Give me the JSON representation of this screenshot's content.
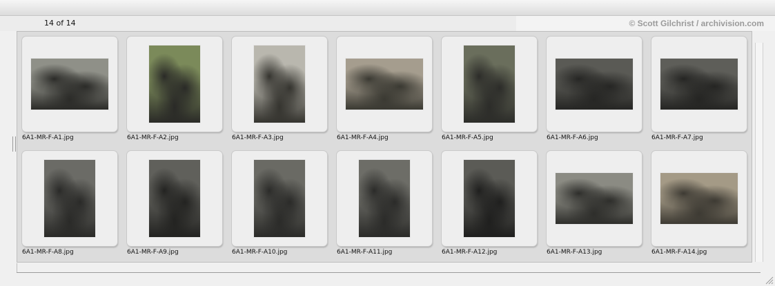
{
  "status": {
    "counter": "14 of 14"
  },
  "credit": "© Scott Gilchrist / archivision.com",
  "thumbnails": [
    {
      "filename": "6A1-MR-F-A1.jpg",
      "icon": "sculpture-photo-icon",
      "bg": "#8f9088",
      "fg": "#2b2b28"
    },
    {
      "filename": "6A1-MR-F-A2.jpg",
      "icon": "sculpture-photo-icon",
      "bg": "#7b8a5a",
      "fg": "#2a2a27"
    },
    {
      "filename": "6A1-MR-F-A3.jpg",
      "icon": "sculpture-photo-icon",
      "bg": "#b9b7ae",
      "fg": "#35342f"
    },
    {
      "filename": "6A1-MR-F-A4.jpg",
      "icon": "sculpture-photo-icon",
      "bg": "#a59d8e",
      "fg": "#3a3932"
    },
    {
      "filename": "6A1-MR-F-A5.jpg",
      "icon": "sculpture-photo-icon",
      "bg": "#6a6e5c",
      "fg": "#2c2c29"
    },
    {
      "filename": "6A1-MR-F-A6.jpg",
      "icon": "sculpture-photo-icon",
      "bg": "#5a5a55",
      "fg": "#262624"
    },
    {
      "filename": "6A1-MR-F-A7.jpg",
      "icon": "sculpture-photo-icon",
      "bg": "#5e5e59",
      "fg": "#252523"
    },
    {
      "filename": "6A1-MR-F-A8.jpg",
      "icon": "sculpture-photo-icon",
      "bg": "#6b6b66",
      "fg": "#2a2a28"
    },
    {
      "filename": "6A1-MR-F-A9.jpg",
      "icon": "sculpture-photo-icon",
      "bg": "#60605b",
      "fg": "#232321"
    },
    {
      "filename": "6A1-MR-F-A10.jpg",
      "icon": "sculpture-photo-icon",
      "bg": "#6a6a64",
      "fg": "#2b2b29"
    },
    {
      "filename": "6A1-MR-F-A11.jpg",
      "icon": "sculpture-photo-icon",
      "bg": "#6d6d67",
      "fg": "#2b2b29"
    },
    {
      "filename": "6A1-MR-F-A12.jpg",
      "icon": "sculpture-photo-icon",
      "bg": "#5b5b56",
      "fg": "#1f1f1e"
    },
    {
      "filename": "6A1-MR-F-A13.jpg",
      "icon": "sculpture-photo-icon",
      "bg": "#8b8b83",
      "fg": "#2e2e2b"
    },
    {
      "filename": "6A1-MR-F-A14.jpg",
      "icon": "sculpture-photo-icon",
      "bg": "#a49a86",
      "fg": "#3d3a33"
    }
  ],
  "colors": {
    "panel": "#dcdcdc",
    "card": "#eeeeee",
    "text": "#111111",
    "credit": "#9a9a9a"
  }
}
